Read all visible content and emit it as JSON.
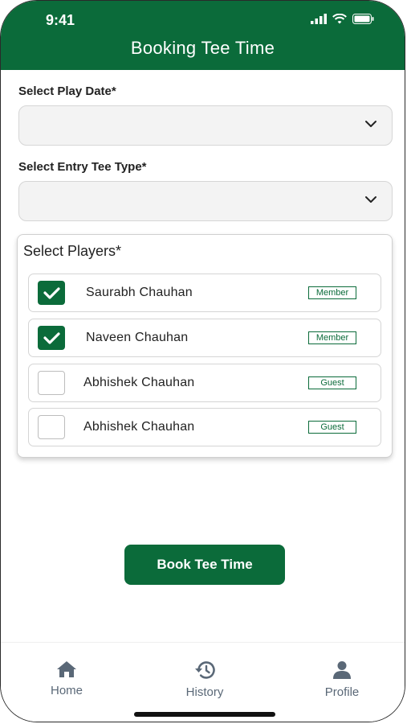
{
  "status_bar": {
    "time": "9:41"
  },
  "header": {
    "title": "Booking Tee Time"
  },
  "form": {
    "play_date_label": "Select Play Date*",
    "play_date_value": "",
    "tee_type_label": "Select Entry Tee Type*",
    "tee_type_value": ""
  },
  "players": {
    "title": "Select Players*",
    "items": [
      {
        "name": "Saurabh Chauhan",
        "type": "Member",
        "checked": true
      },
      {
        "name": "Naveen Chauhan",
        "type": "Member",
        "checked": true
      },
      {
        "name": "Abhishek Chauhan",
        "type": "Guest",
        "checked": false
      },
      {
        "name": "Abhishek Chauhan",
        "type": "Guest",
        "checked": false
      }
    ]
  },
  "actions": {
    "book_label": "Book Tee Time"
  },
  "tabbar": {
    "items": [
      {
        "label": "Home",
        "icon": "home-icon"
      },
      {
        "label": "History",
        "icon": "history-icon"
      },
      {
        "label": "Profile",
        "icon": "profile-icon"
      }
    ]
  },
  "colors": {
    "brand": "#0b6b3a",
    "tab_inactive": "#5a6877"
  }
}
